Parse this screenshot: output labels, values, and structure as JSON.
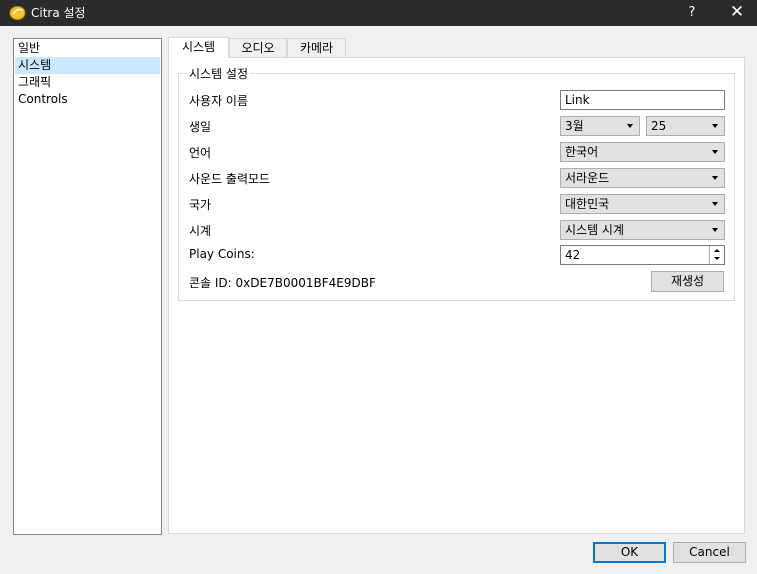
{
  "window": {
    "title": "Citra 설정",
    "help_label": "?",
    "close_label": "✕"
  },
  "sidebar": {
    "items": [
      {
        "label": "일반"
      },
      {
        "label": "시스템",
        "selected": true
      },
      {
        "label": "그래픽"
      },
      {
        "label": "Controls"
      }
    ]
  },
  "tabs": [
    {
      "label": "시스템",
      "active": true
    },
    {
      "label": "오디오"
    },
    {
      "label": "카메라"
    }
  ],
  "system": {
    "group_title": "시스템 설정",
    "username": {
      "label": "사용자 이름",
      "value": "Link"
    },
    "birthday": {
      "label": "생일",
      "month": "3월",
      "day": "25"
    },
    "language": {
      "label": "언어",
      "value": "한국어"
    },
    "sound": {
      "label": "사운드 출력모드",
      "value": "서라운드"
    },
    "country": {
      "label": "국가",
      "value": "대한민국"
    },
    "clock": {
      "label": "시계",
      "value": "시스템 시계"
    },
    "play_coins": {
      "label": "Play Coins:",
      "value": "42"
    },
    "console_id": {
      "label": "콘솔 ID: 0xDE7B0001BF4E9DBF",
      "button": "재생성"
    }
  },
  "footer": {
    "ok_label": "OK",
    "cancel_label": "Cancel"
  }
}
